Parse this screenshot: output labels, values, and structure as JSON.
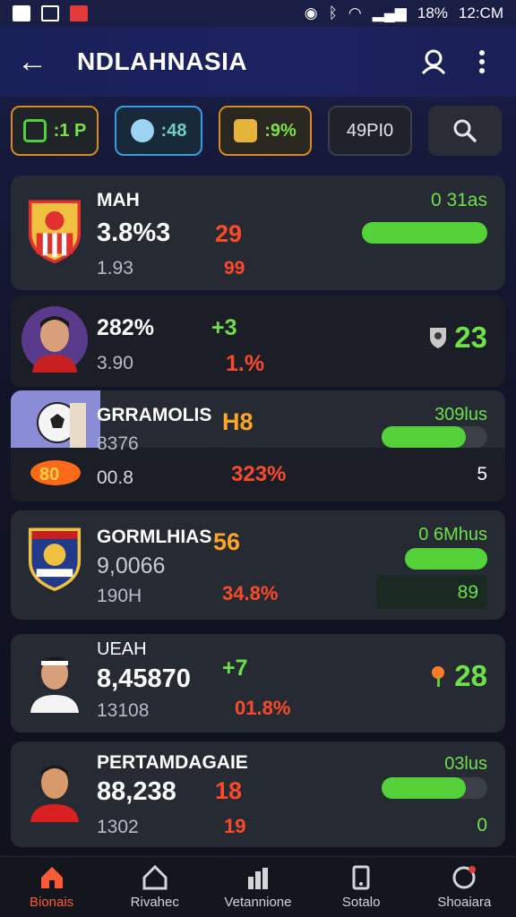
{
  "status_bar": {
    "battery": "18%",
    "time": "12:CM"
  },
  "header": {
    "title": "NDLAHNASIA"
  },
  "filters": [
    {
      "label": ":1 P"
    },
    {
      "label": ":48"
    },
    {
      "label": ":9%"
    },
    {
      "label": "49PI0"
    }
  ],
  "cards": [
    {
      "name": "MAH",
      "value": "3.8%3",
      "sub": "1.93",
      "mid_top": "29",
      "mid_bottom": "99",
      "right_label": "0 31as",
      "progress": 1.0
    },
    {
      "name": "",
      "value": "282%",
      "sub": "3.90",
      "mid_top": "+3",
      "mid_bottom": "1.%",
      "right_label": "23"
    },
    {
      "name": "GRRAMOLIS",
      "value": "8376",
      "sub": "00.8",
      "mid_top": "H8",
      "mid_bottom": "323%",
      "right_label": "309lus",
      "right_bottom": "5",
      "progress": 0.8
    },
    {
      "name": "GORMLHIAS",
      "value": "9,0066",
      "sub": "190H",
      "mid_top": "56",
      "mid_bottom": "34.8%",
      "right_label": "0 6Mhus",
      "right_bottom": "89",
      "progress": 1.0
    },
    {
      "name": "UEAH",
      "value": "8,45870",
      "sub": "13108",
      "mid_top": "+7",
      "mid_bottom": "01.8%",
      "right_label": "28"
    },
    {
      "name": "PERTAMDAGAIE",
      "value": "88,238",
      "sub": "1302",
      "mid_top": "18",
      "mid_bottom": "19",
      "right_label": "03lus",
      "right_bottom": "0",
      "progress": 0.8
    }
  ],
  "tabs": [
    {
      "label": "Bionais",
      "icon": "home-icon",
      "active": true
    },
    {
      "label": "Rivahec",
      "icon": "house-icon",
      "active": false
    },
    {
      "label": "Vetannione",
      "icon": "chart-icon",
      "active": false
    },
    {
      "label": "Sotalo",
      "icon": "device-icon",
      "active": false
    },
    {
      "label": "Shoaiara",
      "icon": "profile-icon",
      "active": false
    }
  ],
  "colors": {
    "accent": "#55d13a",
    "danger": "#ff4a2a",
    "warning": "#ffa52a",
    "header": "#1d2260"
  }
}
